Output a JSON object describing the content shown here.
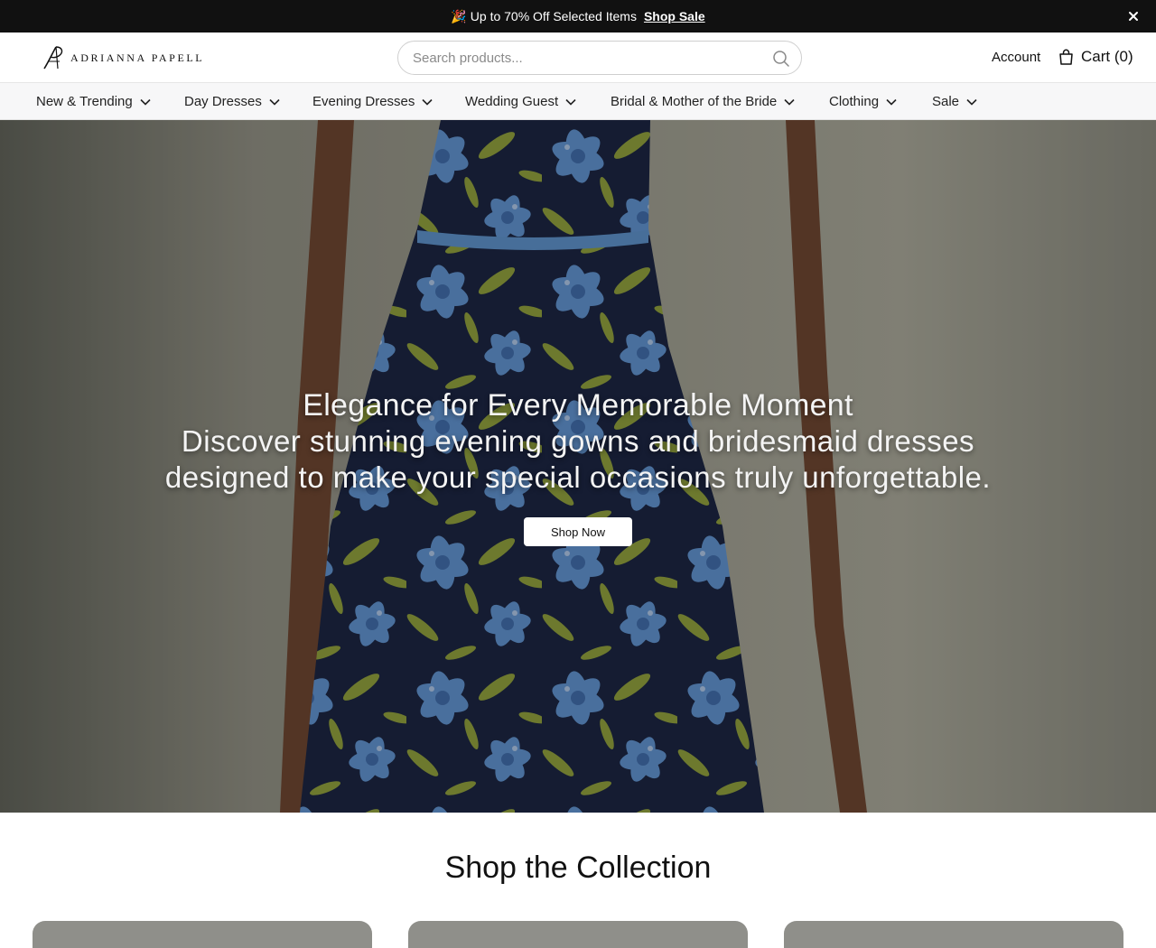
{
  "announcement": {
    "emoji": "🎉",
    "text": "Up to 70% Off Selected Items",
    "link_label": "Shop Sale"
  },
  "header": {
    "logo_text": "ADRIANNA PAPELL",
    "search_placeholder": "Search products...",
    "account_label": "Account",
    "cart_label": "Cart (0)"
  },
  "nav": {
    "items": [
      {
        "label": "New & Trending"
      },
      {
        "label": "Day Dresses"
      },
      {
        "label": "Evening Dresses"
      },
      {
        "label": "Wedding Guest"
      },
      {
        "label": "Bridal & Mother of the Bride"
      },
      {
        "label": "Clothing"
      },
      {
        "label": "Sale"
      }
    ]
  },
  "hero": {
    "title": "Elegance for Every Memorable Moment",
    "subtitle_line1": "Discover stunning evening gowns and bridesmaid dresses",
    "subtitle_line2": "designed to make your special occasions truly unforgettable.",
    "cta_label": "Shop Now"
  },
  "collection": {
    "title": "Shop the Collection"
  },
  "icons": {
    "close": "close-icon",
    "search": "search-icon",
    "cart": "shopping-bag-icon",
    "chevron": "chevron-down-icon"
  },
  "colors": {
    "announcement_bg": "#111111",
    "nav_bg": "#f7f7f8",
    "dress_navy": "#1a2440",
    "dress_blue": "#5d8ec8",
    "dress_olive": "#8a9a3a"
  }
}
